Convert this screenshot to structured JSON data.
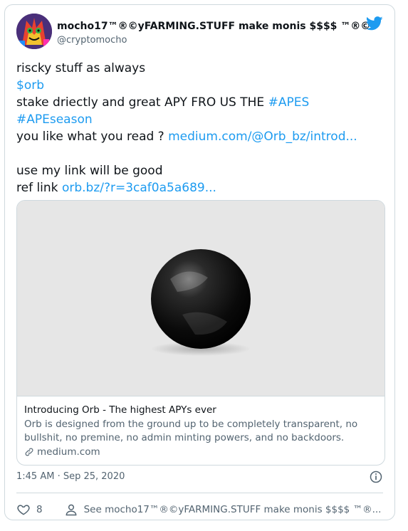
{
  "header": {
    "display_name": "mocho17™®©yFARMING.STUFF make monis $$$$ ™®©",
    "handle": "@cryptomocho"
  },
  "tweet": {
    "line1": "riscky stuff as always",
    "cashtag": "$orb",
    "line3_text": "stake driectly and great APY FRO US THE ",
    "hashtag1": "#APES",
    "hashtag2": "#APEseason",
    "line5_text": "you like what you read ? ",
    "link1": "medium.com/@Orb_bz/introd...",
    "line7": "use my link will be good",
    "line8_text": "ref link ",
    "link2": "orb.bz/?r=3caf0a5a689..."
  },
  "preview": {
    "title": "Introducing Orb - The highest APYs ever",
    "description": "Orb is designed from the ground up to be completely transparent, no bullshit, no premine, no admin minting powers, and no backdoors.",
    "domain": "medium.com"
  },
  "meta": {
    "timestamp": "1:45 AM · Sep 25, 2020"
  },
  "actions": {
    "like_count": "8",
    "profile_link": "See mocho17™®©yFARMING.STUFF make monis $$$$ ™®..."
  },
  "colors": {
    "link": "#1d9bf0",
    "twitter_blue": "#1d9bf0",
    "muted": "#536471"
  }
}
